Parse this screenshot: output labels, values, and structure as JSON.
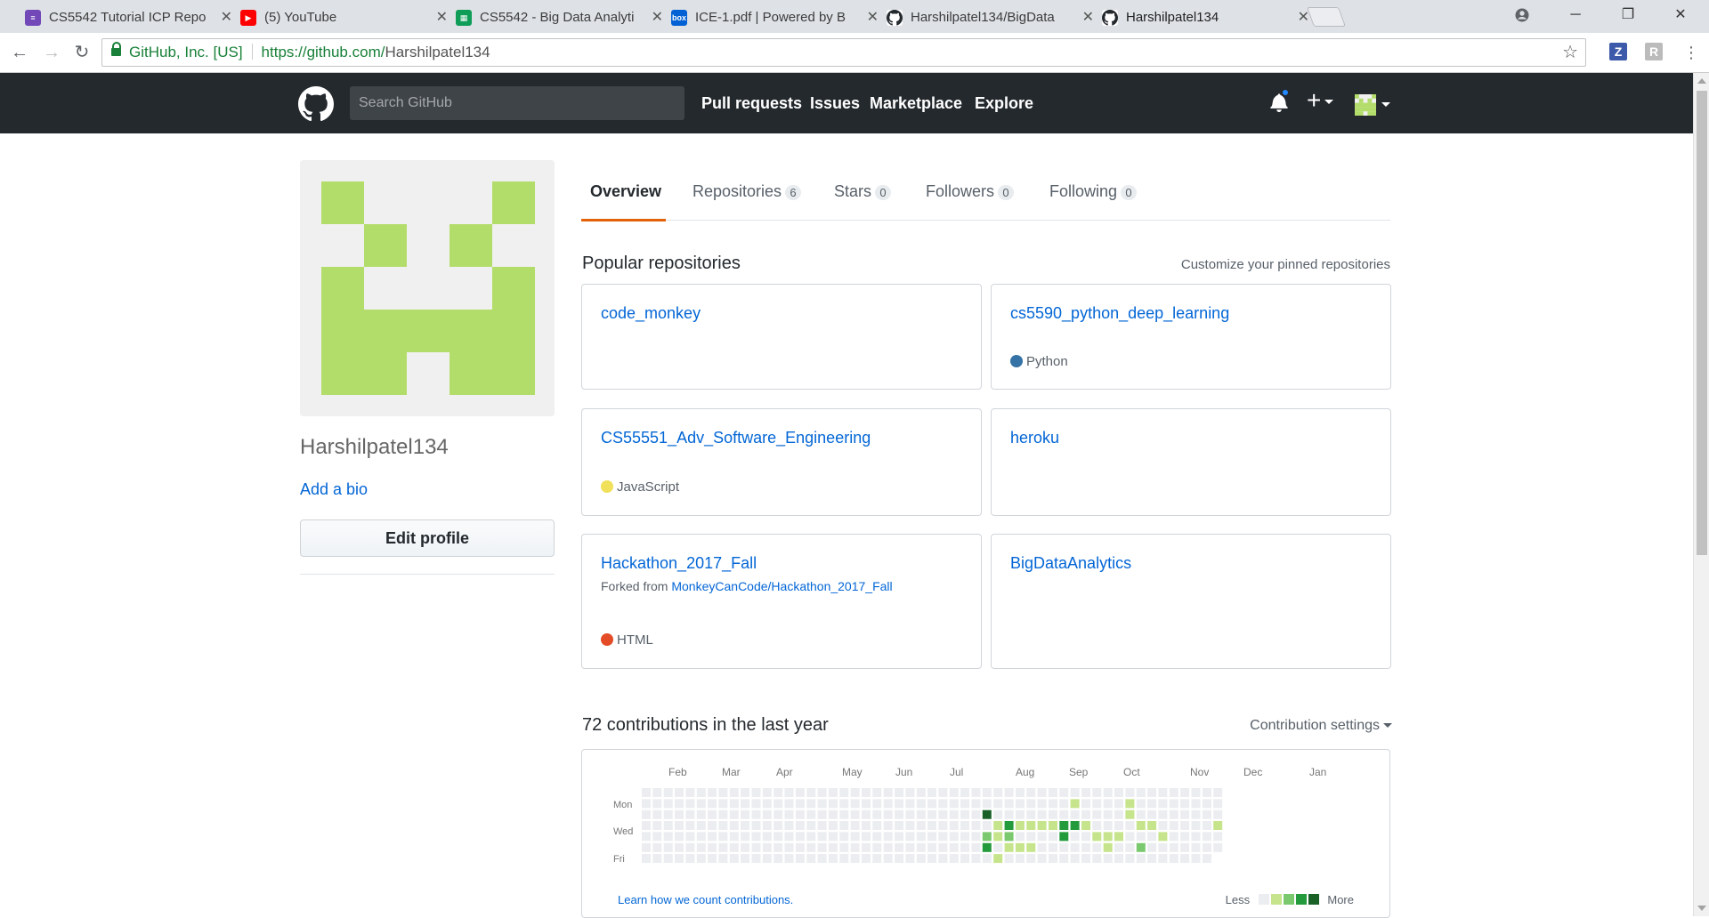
{
  "browser": {
    "tabs": [
      {
        "label": "CS5542 Tutorial ICP Repo",
        "icon": "forms-icon",
        "color": "#7248b9"
      },
      {
        "label": "(5) YouTube",
        "icon": "youtube-icon",
        "color": "#ff0000"
      },
      {
        "label": "CS5542 - Big Data Analyti",
        "icon": "sheets-icon",
        "color": "#0f9d58"
      },
      {
        "label": "ICE-1.pdf | Powered by B",
        "icon": "box-icon",
        "color": "#0061d5"
      },
      {
        "label": "Harshilpatel134/BigData",
        "icon": "github-icon",
        "color": "#24292e"
      },
      {
        "label": "Harshilpatel134",
        "icon": "github-icon",
        "color": "#24292e"
      }
    ],
    "active_tab": 5,
    "security_label": "GitHub, Inc. [US]",
    "url_host": "https://github.com/",
    "url_path": "Harshilpatel134",
    "extensions": [
      {
        "label": "Z",
        "color": "#3d5aaa"
      },
      {
        "label": "R",
        "color": "#bbbbbb"
      }
    ]
  },
  "header": {
    "search_placeholder": "Search GitHub",
    "nav": [
      "Pull requests",
      "Issues",
      "Marketplace",
      "Explore"
    ],
    "plus_label": "+"
  },
  "profile": {
    "username": "Harshilpatel134",
    "add_bio": "Add a bio",
    "edit_profile": "Edit profile",
    "avatar_color": "#b3dd6b"
  },
  "tabs": [
    {
      "label": "Overview",
      "count": null
    },
    {
      "label": "Repositories",
      "count": "6"
    },
    {
      "label": "Stars",
      "count": "0"
    },
    {
      "label": "Followers",
      "count": "0"
    },
    {
      "label": "Following",
      "count": "0"
    }
  ],
  "popular": {
    "title": "Popular repositories",
    "customize": "Customize your pinned repositories",
    "repos": [
      {
        "name": "code_monkey",
        "language": null,
        "lang_color": null,
        "forked_from": null
      },
      {
        "name": "cs5590_python_deep_learning",
        "language": "Python",
        "lang_color": "#3572a5",
        "forked_from": null
      },
      {
        "name": "CS55551_Adv_Software_Engineering",
        "language": "JavaScript",
        "lang_color": "#f1e05a",
        "forked_from": null
      },
      {
        "name": "heroku",
        "language": null,
        "lang_color": null,
        "forked_from": null
      },
      {
        "name": "Hackathon_2017_Fall",
        "language": "HTML",
        "lang_color": "#e34c26",
        "forked_from": "MonkeyCanCode/Hackathon_2017_Fall",
        "forked_prefix": "Forked from "
      },
      {
        "name": "BigDataAnalytics",
        "language": null,
        "lang_color": null,
        "forked_from": null
      }
    ]
  },
  "contributions": {
    "title": "72 contributions in the last year",
    "settings": "Contribution settings",
    "months": [
      "Feb",
      "Mar",
      "Apr",
      "May",
      "Jun",
      "Jul",
      "Aug",
      "Sep",
      "Oct",
      "Nov",
      "Dec",
      "Jan"
    ],
    "weekdays": [
      "Mon",
      "Wed",
      "Fri"
    ],
    "learn": "Learn how we count contributions.",
    "legend_less": "Less",
    "legend_more": "More",
    "levels": [
      "#ebedf0",
      "#c6e48b",
      "#7bc96f",
      "#239a3b",
      "#196127"
    ],
    "active_cells": [
      [
        31,
        2,
        4
      ],
      [
        31,
        4,
        2
      ],
      [
        31,
        5,
        3
      ],
      [
        32,
        3,
        1
      ],
      [
        32,
        4,
        1
      ],
      [
        32,
        6,
        1
      ],
      [
        33,
        3,
        3
      ],
      [
        33,
        4,
        2
      ],
      [
        33,
        5,
        1
      ],
      [
        34,
        3,
        1
      ],
      [
        34,
        5,
        1
      ],
      [
        35,
        3,
        1
      ],
      [
        35,
        5,
        1
      ],
      [
        36,
        3,
        1
      ],
      [
        37,
        3,
        1
      ],
      [
        38,
        3,
        3
      ],
      [
        38,
        4,
        3
      ],
      [
        39,
        1,
        1
      ],
      [
        39,
        3,
        3
      ],
      [
        40,
        3,
        1
      ],
      [
        41,
        4,
        1
      ],
      [
        42,
        4,
        1
      ],
      [
        42,
        5,
        1
      ],
      [
        43,
        4,
        1
      ],
      [
        44,
        1,
        1
      ],
      [
        44,
        2,
        1
      ],
      [
        45,
        3,
        1
      ],
      [
        45,
        5,
        2
      ],
      [
        46,
        3,
        1
      ],
      [
        47,
        4,
        1
      ],
      [
        52,
        3,
        1
      ]
    ]
  }
}
